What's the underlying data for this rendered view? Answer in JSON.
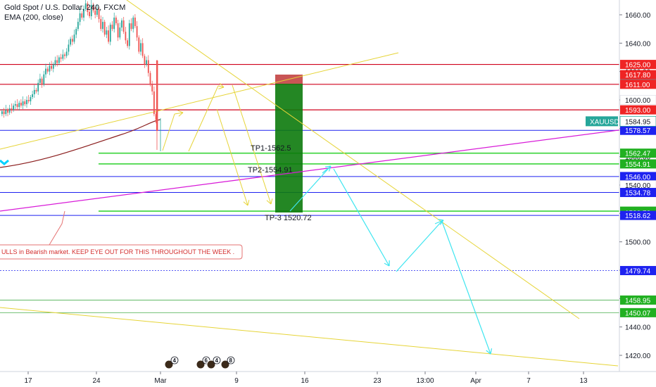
{
  "legend": {
    "symbol": "Gold Spot / U.S. Dollar, 240, FXCM",
    "indicator": "EMA (200, close)"
  },
  "chart_data": {
    "type": "candlestick",
    "symbol": "XAUUSD",
    "timeframe": "240",
    "ylim": [
      1407,
      1676
    ],
    "y_ticks": [
      1420.0,
      1440.0,
      1460.0,
      1480.0,
      1500.0,
      1520.0,
      1540.0,
      1560.0,
      1580.0,
      1600.0,
      1620.0,
      1640.0,
      1660.0
    ],
    "x_ticks": [
      "17",
      "24",
      "Mar",
      "9",
      "16",
      "23",
      "13:00",
      "Apr",
      "7",
      "13"
    ],
    "current_price_tag": {
      "label": "XAUUSD",
      "value": "1584.95",
      "color": "#26a69a"
    },
    "price_tags": [
      {
        "value": "1625.00",
        "color": "#ef2424"
      },
      {
        "value": "1617.80",
        "color": "#ef2424"
      },
      {
        "value": "1611.38",
        "color": "#787b86"
      },
      {
        "value": "1611.00",
        "color": "#ef2424"
      },
      {
        "value": "1600.00",
        "color": "#ffffff"
      },
      {
        "value": "1593.00",
        "color": "#ef2424"
      },
      {
        "value": "1578.57",
        "color": "#1e22f0"
      },
      {
        "value": "1562.47",
        "color": "#21b021"
      },
      {
        "value": "1554.91",
        "color": "#21b021"
      },
      {
        "value": "1546.00",
        "color": "#1e22f0"
      },
      {
        "value": "1540.00",
        "color": "#ffffff"
      },
      {
        "value": "1534.78",
        "color": "#1e22f0"
      },
      {
        "value": "1521.60",
        "color": "#21b021"
      },
      {
        "value": "1520.72",
        "color": "#21b021"
      },
      {
        "value": "1518.62",
        "color": "#1e22f0"
      },
      {
        "value": "1479.74",
        "color": "#1e22f0"
      },
      {
        "value": "1458.95",
        "color": "#21b021"
      },
      {
        "value": "1450.07",
        "color": "#21b021"
      }
    ],
    "tp_labels": [
      "TP1-1562.5",
      "TP2-1554.91",
      "TP-3 1520.72"
    ],
    "note_text": "ULLS in Bearish market. KEEP EYE OUT FOR THIS THROUGHOUT THE WEEK .",
    "event_badges": [
      "4",
      "6",
      "4",
      "8"
    ],
    "colors": {
      "up": "#26a69a",
      "down": "#ef5350",
      "red_line": "#d0021b",
      "blue_line": "#1e22f0",
      "green_line": "#3ad43a",
      "magenta_line": "#d81bd8",
      "yellow_line": "#e6d437",
      "cyan_arrow": "#3fe5f0",
      "ema": "#8a1c1c"
    }
  }
}
